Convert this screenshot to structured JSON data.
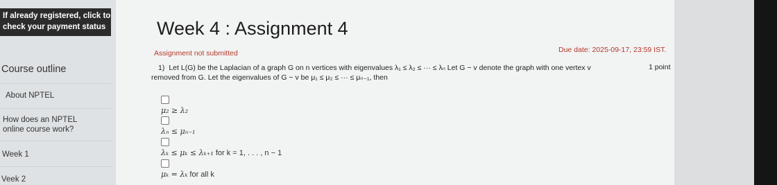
{
  "sidebar": {
    "registration_banner": {
      "line1": "If already registered, click to",
      "line2": "check your payment status"
    },
    "heading": "Course outline",
    "items": [
      {
        "label": "About NPTEL"
      },
      {
        "label_line1": "How does an NPTEL",
        "label_line2": "online course work?"
      },
      {
        "label": "Week 1"
      },
      {
        "label": "Veek 2"
      }
    ]
  },
  "assignment": {
    "title": "Week 4 : Assignment 4",
    "status": "Assignment not submitted",
    "due_date": "Due date: 2025-09-17, 23:59 IST."
  },
  "question": {
    "number": "1)",
    "text_line1": "Let L(G) be the Laplacian of a graph G on n vertices with eigenvalues λ₁ ≤ λ₂ ≤ ··· ≤ λₙ Let G − v denote the graph with one vertex v",
    "text_line2": "removed from G. Let the eigenvalues of G − v be μ₁ ≤ μ₂ ≤ ··· ≤ μₙ₋₁, then",
    "points": "1 point",
    "options": [
      {
        "math": "μ₂ ≥ λ₂",
        "suffix": ""
      },
      {
        "math": "λₙ ≤ μₙ₋₁",
        "suffix": ""
      },
      {
        "math": "λₖ ≤ μₖ ≤ λₖ₊₁",
        "suffix": " for k = 1, . . . , n − 1"
      },
      {
        "math": "μₖ = λₖ",
        "suffix": " for all k"
      }
    ]
  }
}
